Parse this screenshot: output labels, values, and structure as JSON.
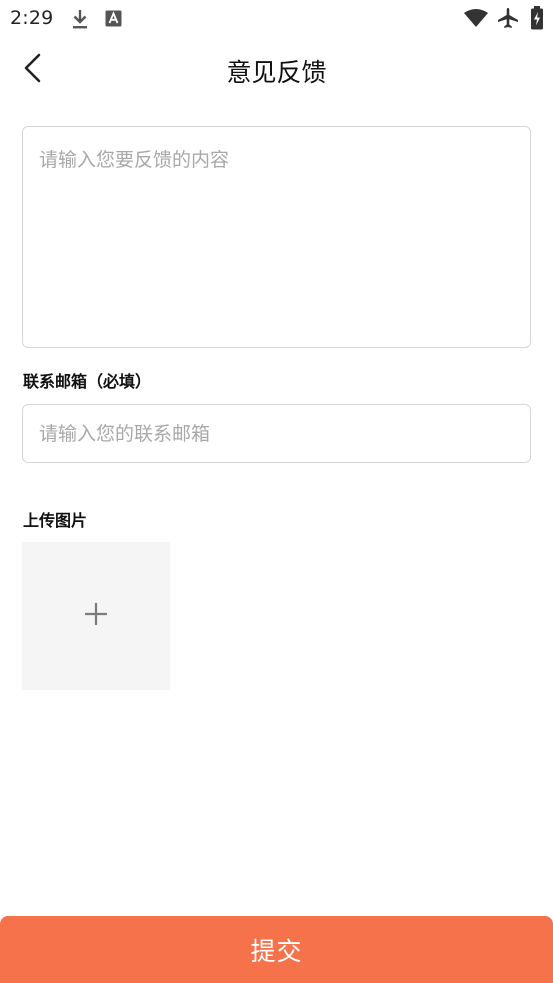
{
  "status_bar": {
    "time": "2:29",
    "left_icons": [
      "download-icon",
      "app-a-icon"
    ],
    "right_icons": [
      "wifi-icon",
      "airplane-icon",
      "battery-charging-icon"
    ]
  },
  "header": {
    "title": "意见反馈",
    "back_icon": "chevron-left-icon"
  },
  "feedback": {
    "placeholder": "请输入您要反馈的内容",
    "value": ""
  },
  "email": {
    "label": "联系邮箱（必填）",
    "placeholder": "请输入您的联系邮箱",
    "value": ""
  },
  "upload": {
    "label": "上传图片",
    "add_icon": "plus-icon"
  },
  "submit": {
    "label": "提交"
  },
  "colors": {
    "accent": "#f6724b",
    "border": "#d6d6d6",
    "placeholder": "#a8a8a8",
    "tile_bg": "#f5f5f5"
  }
}
